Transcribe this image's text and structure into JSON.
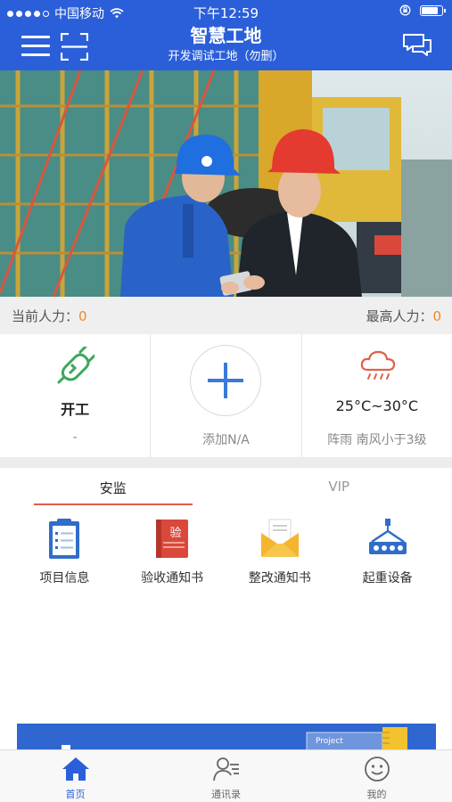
{
  "status_bar": {
    "carrier": "中国移动",
    "time": "下午12:59",
    "battery_level": 0.85
  },
  "header": {
    "title": "智慧工地",
    "subtitle": "开发调试工地（勿删）"
  },
  "manpower": {
    "current_label": "当前人力：",
    "current_value": "0",
    "max_label": "最高人力：",
    "max_value": "0"
  },
  "cards": {
    "work": {
      "title": "开工",
      "sub": "-"
    },
    "add": {
      "sub": "添加N/A"
    },
    "weather": {
      "title": "25°C~30°C",
      "sub": "阵雨 南风小于3级"
    }
  },
  "tabs": [
    {
      "label": "安监"
    },
    {
      "label": "VIP"
    }
  ],
  "grid": [
    {
      "label": "项目信息",
      "icon": "clipboard-icon"
    },
    {
      "label": "验收通知书",
      "icon": "inspection-book-icon",
      "glyph": "验"
    },
    {
      "label": "整改通知书",
      "icon": "envelope-icon"
    },
    {
      "label": "起重设备",
      "icon": "crane-icon"
    }
  ],
  "promo": {
    "text": "Project"
  },
  "bottom_nav": [
    {
      "label": "首页",
      "icon": "home-icon"
    },
    {
      "label": "通讯录",
      "icon": "contacts-icon"
    },
    {
      "label": "我的",
      "icon": "profile-icon"
    }
  ],
  "colors": {
    "primary": "#2b5fd9",
    "accent_orange": "#f0882a",
    "tab_underline": "#e05a4e",
    "icon_green": "#3aa85a",
    "icon_red": "#d9483b",
    "icon_yellow": "#f4b52f"
  }
}
